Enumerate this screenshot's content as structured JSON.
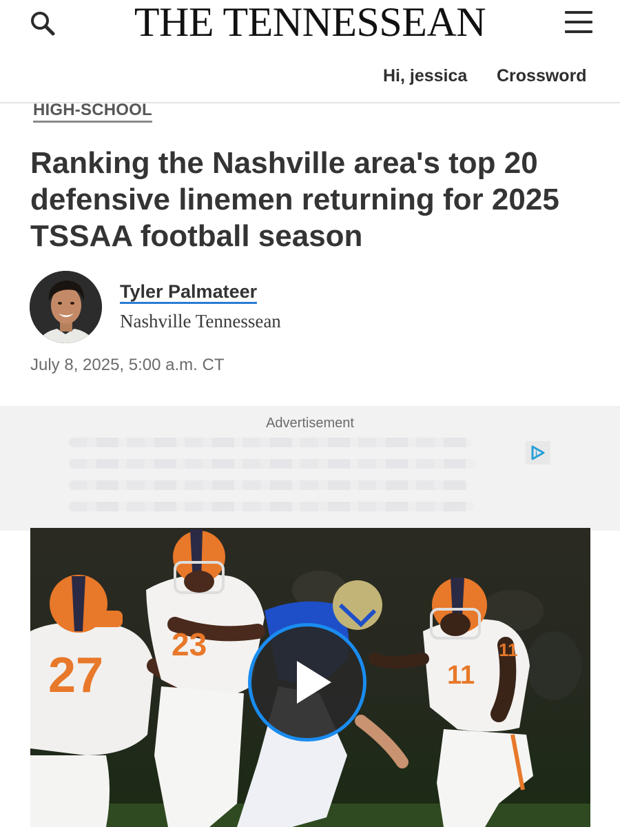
{
  "header": {
    "masthead": "THE TENNESSEAN",
    "greeting": "Hi, jessica",
    "crossword": "Crossword",
    "icons": {
      "search": "search-icon",
      "menu": "hamburger-menu-icon"
    }
  },
  "article": {
    "section": "HIGH-SCHOOL",
    "headline": "Ranking the Nashville area's top 20 defensive linemen returning for 2025 TSSAA football season",
    "author": {
      "name": "Tyler Palmateer",
      "organization": "Nashville Tennessean"
    },
    "dateline": "July 8, 2025, 5:00 a.m. CT"
  },
  "ad": {
    "label": "Advertisement"
  },
  "video": {
    "jersey_numbers": [
      "27",
      "23",
      "11"
    ],
    "play_icon": "play-icon"
  },
  "colors": {
    "accent_blue": "#1a8cf0",
    "text_dark": "#343434",
    "jersey_orange": "#e8782a"
  }
}
